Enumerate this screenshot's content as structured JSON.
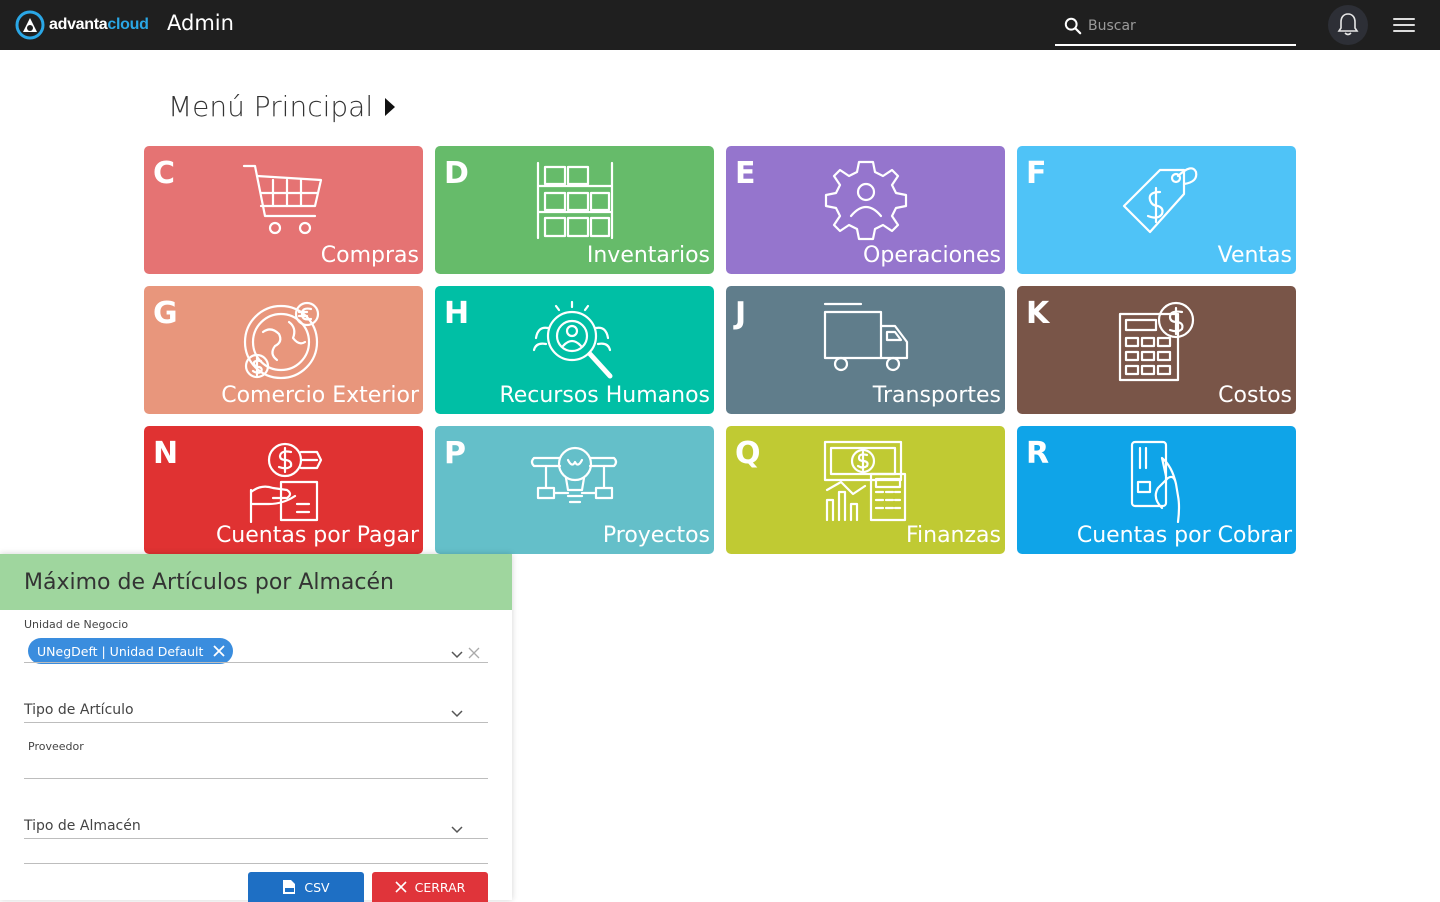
{
  "header": {
    "logo_part1": "advanta",
    "logo_part2": "cloud",
    "app_title": "Admin",
    "search_placeholder": "Buscar"
  },
  "main": {
    "title": "Menú Principal",
    "tiles": [
      {
        "key": "C",
        "label": "Compras",
        "color": "#e57373",
        "icon": "shopping-cart-icon"
      },
      {
        "key": "D",
        "label": "Inventarios",
        "color": "#66bb6a",
        "icon": "boxes-icon"
      },
      {
        "key": "E",
        "label": "Operaciones",
        "color": "#9575cd",
        "icon": "gear-user-icon"
      },
      {
        "key": "F",
        "label": "Ventas",
        "color": "#4fc3f7",
        "icon": "price-tag-icon"
      },
      {
        "key": "G",
        "label": "Comercio Exterior",
        "color": "#e8967c",
        "icon": "globe-currency-icon"
      },
      {
        "key": "H",
        "label": "Recursos Humanos",
        "color": "#00bfa5",
        "icon": "people-search-icon"
      },
      {
        "key": "J",
        "label": "Transportes",
        "color": "#607d8b",
        "icon": "truck-icon"
      },
      {
        "key": "K",
        "label": "Costos",
        "color": "#795548",
        "icon": "calculator-dollar-icon"
      },
      {
        "key": "N",
        "label": "Cuentas por Pagar",
        "color": "#e03232",
        "icon": "hand-coin-icon"
      },
      {
        "key": "P",
        "label": "Proyectos",
        "color": "#64bfc9",
        "icon": "idea-icon"
      },
      {
        "key": "Q",
        "label": "Finanzas",
        "color": "#c0ca33",
        "icon": "finance-icon"
      },
      {
        "key": "R",
        "label": "Cuentas por Cobrar",
        "color": "#0fa4e8",
        "icon": "card-hand-icon"
      }
    ]
  },
  "panel": {
    "title": "Máximo de Artículos por Almacén",
    "unidad_label": "Unidad de Negocio",
    "unidad_chip": "UNegDeft | Unidad Default",
    "tipo_articulo_label": "Tipo de Artículo",
    "proveedor_label": "Proveedor",
    "tipo_almacen_label": "Tipo de Almacén",
    "csv_label": "CSV",
    "close_label": "CERRAR"
  },
  "colors": {
    "topbar": "#1f1f1f",
    "panel_header": "#9fd69e",
    "chip": "#3a8dde",
    "csv_button": "#1e6fc4",
    "close_button": "#e0343a"
  }
}
